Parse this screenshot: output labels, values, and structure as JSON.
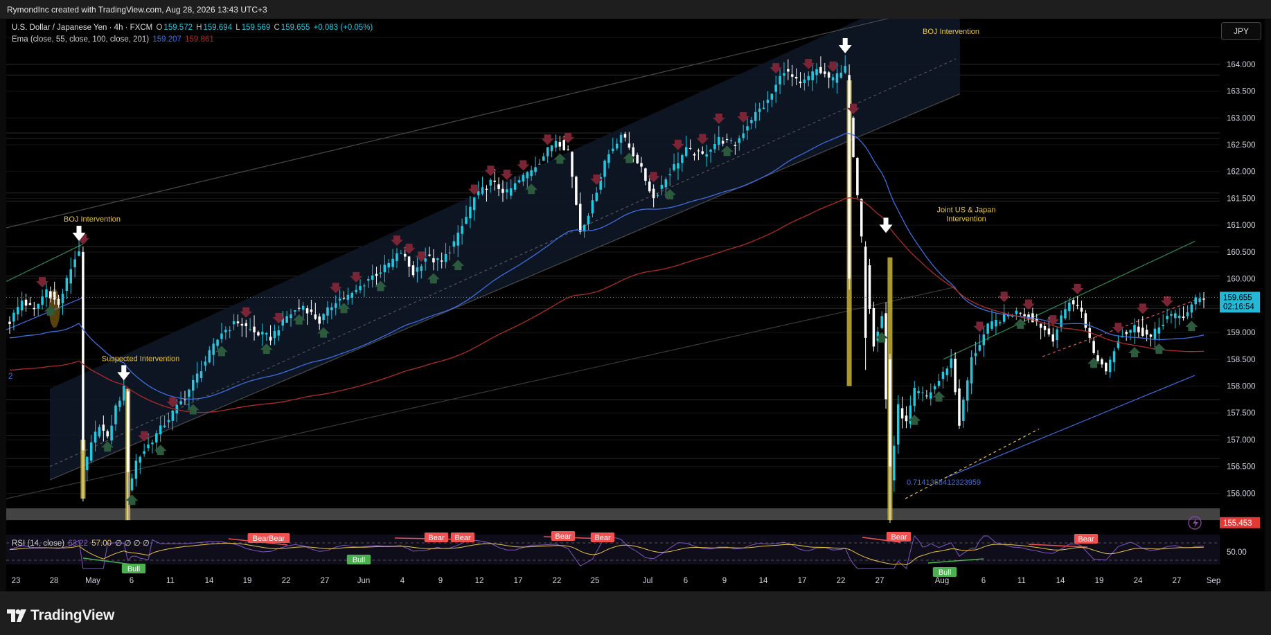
{
  "credit": "RymondInc created with TradingView.com, Aug 28, 2026 13:43 UTC+3",
  "brand": "TradingView",
  "currency_button": "JPY",
  "legend": {
    "symbol": "U.S. Dollar / Japanese Yen · 4h · FXCM",
    "o_label": "O",
    "o": "159.572",
    "h_label": "H",
    "h": "159.694",
    "l_label": "L",
    "l": "159.569",
    "c_label": "C",
    "c": "159.655",
    "change": "+0.083 (+0.05%)",
    "ema_label": "Ema (close, 55, close, 100, close, 201)",
    "ema55": "159.207",
    "ema100": "159.861"
  },
  "rsi_legend": {
    "label": "RSI (14, close)",
    "v1": "63.22",
    "v2": "57.00",
    "v3": "∅ ∅ ∅ ∅"
  },
  "left_marker": "2",
  "colors": {
    "up": "#22c8e0",
    "down": "#ffffff",
    "ema55": "#3f6ee0",
    "ema100": "#b02b2b",
    "annotation": "#e8c547",
    "highlight": "#c8b23a",
    "bear": "#f05252",
    "bull": "#4caf50",
    "channel_fill": "#0e1626",
    "arrow_down": "#7a2535",
    "arrow_up": "#2b5a3c",
    "rsi_line": "#7e57c2",
    "rsi_ma": "#e8c547",
    "price_tag": "#22b8d6",
    "low_tag": "#e53935"
  },
  "chart_data": {
    "type": "candlestick",
    "ylim": [
      155.45,
      164.85
    ],
    "y_ticks": [
      "164.500",
      "164.000",
      "163.500",
      "163.000",
      "162.500",
      "162.000",
      "161.500",
      "161.000",
      "160.500",
      "160.000",
      "159.500",
      "159.000",
      "158.500",
      "158.000",
      "157.500",
      "157.000",
      "156.500",
      "156.000"
    ],
    "y_tick_values": [
      164.5,
      164.0,
      163.5,
      163.0,
      162.5,
      162.0,
      161.5,
      161.0,
      160.5,
      160.0,
      159.5,
      159.0,
      158.5,
      158.0,
      157.5,
      157.0,
      156.5,
      156.0
    ],
    "x_ticks": [
      "23",
      "28",
      "May",
      "6",
      "11",
      "14",
      "19",
      "22",
      "27",
      "Jun",
      "4",
      "9",
      "12",
      "17",
      "22",
      "25",
      "Jul",
      "6",
      "9",
      "14",
      "17",
      "22",
      "27",
      "Aug",
      "6",
      "11",
      "14",
      "19",
      "24",
      "27",
      "Sep"
    ],
    "last_price": "159.655",
    "countdown": "02:16:54",
    "low_price": "155.453",
    "rsi_tick": "50.00",
    "fib_label": "0.7141358412323959",
    "annotations": [
      {
        "text": "BOJ Intervention",
        "date": "Apr 29",
        "price": 160.55
      },
      {
        "text": "Suspected Intervention",
        "date": "May 1",
        "price": 157.95
      },
      {
        "text": "BOJ Intervention",
        "date": "Jul 11",
        "price": 164.05
      },
      {
        "text": "Joint US & Japan Intervention",
        "date": "Jul 31",
        "price": 160.7
      }
    ],
    "divergence_labels": [
      {
        "text": "BearBear"
      },
      {
        "text": "Bear"
      },
      {
        "text": "Bear"
      },
      {
        "text": "Bear"
      },
      {
        "text": "Bear"
      },
      {
        "text": "Bear"
      },
      {
        "text": "Bear"
      },
      {
        "text": "Bear"
      },
      {
        "text": "Bull"
      },
      {
        "text": "Bull"
      },
      {
        "text": "Bull"
      }
    ],
    "price_path": [
      [
        0,
        159.2
      ],
      [
        3,
        159.6
      ],
      [
        6,
        159.4
      ],
      [
        9,
        159.8
      ],
      [
        12,
        159.5
      ],
      [
        15,
        160.2
      ],
      [
        17,
        160.55
      ],
      [
        18,
        156.4
      ],
      [
        20,
        156.9
      ],
      [
        22,
        157.3
      ],
      [
        24,
        157.0
      ],
      [
        26,
        157.6
      ],
      [
        28,
        157.95
      ],
      [
        29,
        156.0
      ],
      [
        31,
        156.6
      ],
      [
        34,
        156.9
      ],
      [
        37,
        157.2
      ],
      [
        40,
        157.5
      ],
      [
        43,
        157.8
      ],
      [
        46,
        158.2
      ],
      [
        49,
        158.6
      ],
      [
        52,
        159.0
      ],
      [
        56,
        159.2
      ],
      [
        60,
        159.0
      ],
      [
        64,
        158.9
      ],
      [
        68,
        159.3
      ],
      [
        72,
        159.5
      ],
      [
        76,
        159.2
      ],
      [
        80,
        159.6
      ],
      [
        84,
        159.7
      ],
      [
        88,
        160.0
      ],
      [
        92,
        160.2
      ],
      [
        96,
        160.5
      ],
      [
        99,
        160.1
      ],
      [
        102,
        160.4
      ],
      [
        106,
        160.3
      ],
      [
        110,
        160.8
      ],
      [
        114,
        161.5
      ],
      [
        118,
        161.8
      ],
      [
        122,
        161.6
      ],
      [
        126,
        161.9
      ],
      [
        130,
        162.2
      ],
      [
        134,
        162.6
      ],
      [
        137,
        162.4
      ],
      [
        140,
        160.9
      ],
      [
        143,
        161.4
      ],
      [
        146,
        162.2
      ],
      [
        150,
        162.7
      ],
      [
        154,
        162.2
      ],
      [
        158,
        161.5
      ],
      [
        162,
        162.0
      ],
      [
        166,
        162.4
      ],
      [
        170,
        162.3
      ],
      [
        174,
        162.6
      ],
      [
        178,
        162.5
      ],
      [
        182,
        163.0
      ],
      [
        186,
        163.3
      ],
      [
        190,
        163.9
      ],
      [
        194,
        163.6
      ],
      [
        198,
        163.9
      ],
      [
        202,
        163.7
      ],
      [
        205,
        164.0
      ],
      [
        206,
        163.0
      ],
      [
        208,
        161.5
      ],
      [
        210,
        160.2
      ],
      [
        212,
        158.8
      ],
      [
        214,
        159.3
      ],
      [
        216,
        156.2
      ],
      [
        218,
        157.6
      ],
      [
        220,
        157.3
      ],
      [
        222,
        157.9
      ],
      [
        225,
        157.8
      ],
      [
        228,
        158.1
      ],
      [
        231,
        158.5
      ],
      [
        233,
        157.3
      ],
      [
        236,
        158.5
      ],
      [
        240,
        159.1
      ],
      [
        244,
        159.3
      ],
      [
        248,
        159.4
      ],
      [
        252,
        159.2
      ],
      [
        256,
        158.9
      ],
      [
        260,
        159.6
      ],
      [
        263,
        159.4
      ],
      [
        266,
        158.6
      ],
      [
        269,
        158.3
      ],
      [
        272,
        158.9
      ],
      [
        276,
        159.1
      ],
      [
        280,
        158.9
      ],
      [
        284,
        159.3
      ],
      [
        288,
        159.3
      ],
      [
        291,
        159.6
      ],
      [
        293,
        159.65
      ]
    ]
  }
}
